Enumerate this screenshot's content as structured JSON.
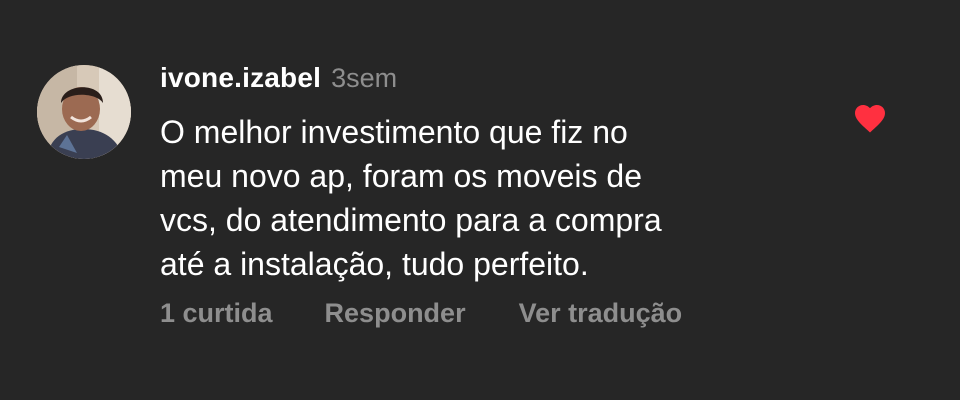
{
  "comment": {
    "username": "ivone.izabel",
    "timestamp": "3sem",
    "text": "O melhor investimento que fiz no\nmeu novo ap, foram os moveis de\nvcs, do atendimento para a compra\naté a instalação, tudo perfeito.",
    "avatar_icon": "user-avatar-photo",
    "liked": true,
    "like_icon": "heart-filled-icon",
    "like_color": "#ff3040"
  },
  "actions": {
    "likes_label": "1 curtida",
    "reply_label": "Responder",
    "translate_label": "Ver tradução"
  },
  "colors": {
    "background": "#262626",
    "text_primary": "#ffffff",
    "text_secondary": "#8e8e8e"
  }
}
